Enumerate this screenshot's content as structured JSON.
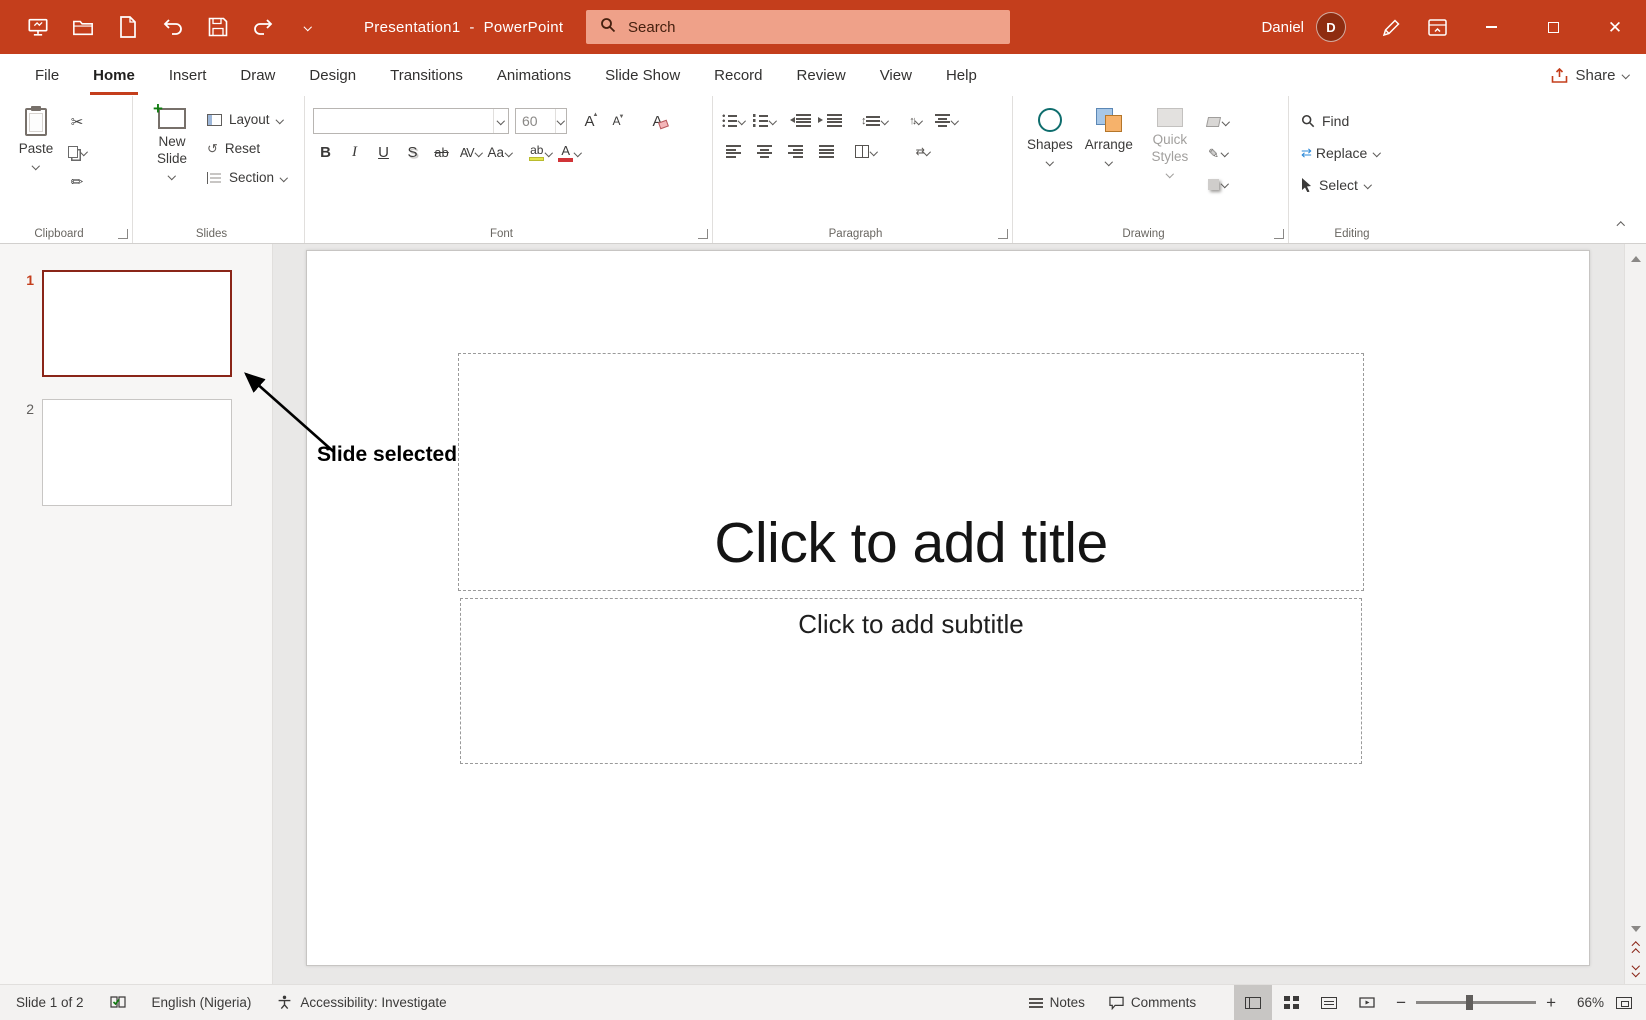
{
  "colors": {
    "brand_red": "#C43E1C",
    "search_box": "#EFA189",
    "thumb_selected_border": "#8A2518"
  },
  "titlebar": {
    "title": "Presentation1  -  PowerPoint",
    "search_placeholder": "Search",
    "user_name": "Daniel",
    "avatar_initial": "D"
  },
  "tabs": {
    "items": [
      "File",
      "Home",
      "Insert",
      "Draw",
      "Design",
      "Transitions",
      "Animations",
      "Slide Show",
      "Record",
      "Review",
      "View",
      "Help"
    ],
    "active_tab": "Home",
    "share_label": "Share"
  },
  "ribbon": {
    "clipboard": {
      "group_label": "Clipboard",
      "paste_label": "Paste"
    },
    "slides": {
      "group_label": "Slides",
      "new_slide_label": "New Slide",
      "layout_label": "Layout",
      "reset_label": "Reset",
      "section_label": "Section"
    },
    "font": {
      "group_label": "Font",
      "size_value": "60",
      "name_value": "",
      "buttons": {
        "bold": "B",
        "italic": "I",
        "underline": "U",
        "shadow": "S",
        "strikethrough": "ab",
        "character_spacing": "AV",
        "change_case": "Aa",
        "grow_font": "A",
        "shrink_font": "A",
        "clear_formatting": "A",
        "highlight": "ab",
        "font_color": "A"
      }
    },
    "paragraph": {
      "group_label": "Paragraph"
    },
    "drawing": {
      "group_label": "Drawing",
      "shapes_label": "Shapes",
      "arrange_label": "Arrange",
      "quick_styles_label": "Quick Styles"
    },
    "editing": {
      "group_label": "Editing",
      "find_label": "Find",
      "replace_label": "Replace",
      "select_label": "Select"
    }
  },
  "slide_panel": {
    "slides": [
      {
        "number": "1",
        "selected": true
      },
      {
        "number": "2",
        "selected": false
      }
    ]
  },
  "annotation": {
    "label": "Slide selected"
  },
  "slide": {
    "title_placeholder": "Click to add title",
    "subtitle_placeholder": "Click to add subtitle"
  },
  "statusbar": {
    "slide_counter": "Slide 1 of 2",
    "language": "English (Nigeria)",
    "accessibility_label": "Accessibility: Investigate",
    "notes_label": "Notes",
    "comments_label": "Comments",
    "zoom_value": "66%"
  }
}
